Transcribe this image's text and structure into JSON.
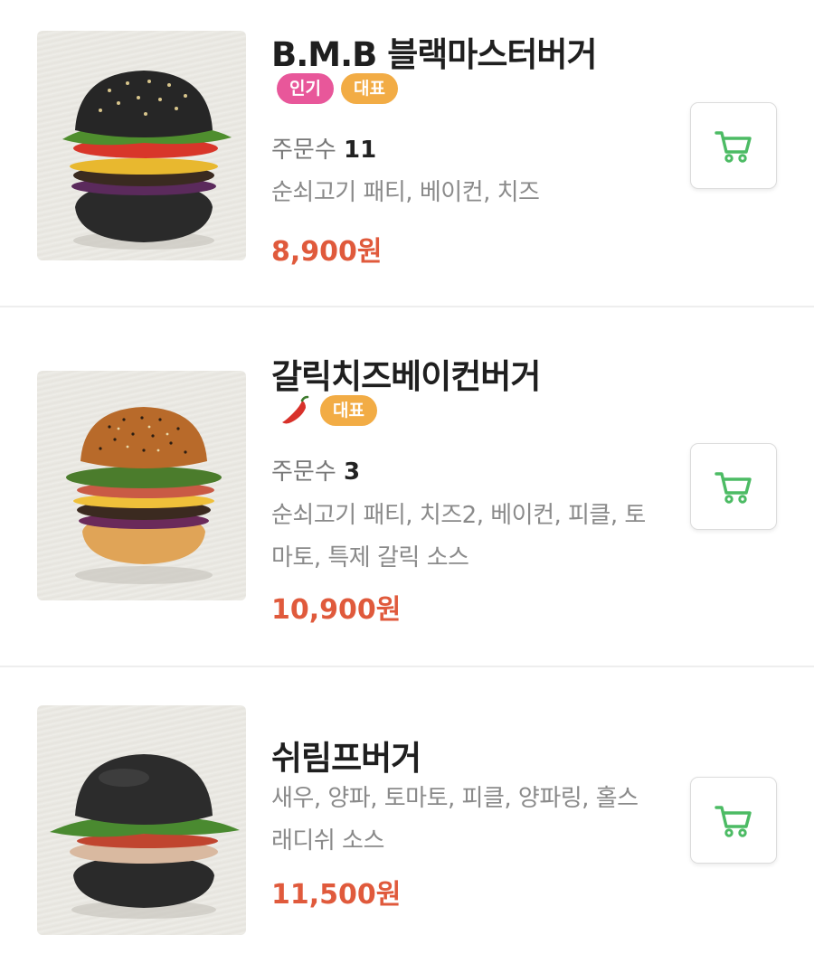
{
  "colors": {
    "accent_price": "#e05a3c",
    "badge_popular": "#e8579a",
    "badge_signature": "#f2ac45",
    "cart_icon": "#4cbb64"
  },
  "items": [
    {
      "name": "B.M.B 블랙마스터버거",
      "badges": [
        "인기",
        "대표"
      ],
      "orders_label": "주문수",
      "orders_count": "11",
      "description": "순쇠고기 패티, 베이컨, 치즈",
      "price": "8,900원",
      "image_icon": "black-burger-photo"
    },
    {
      "name": "갈릭치즈베이컨버거",
      "badges": [
        "대표"
      ],
      "spicy_icon": "chili-pepper-icon",
      "orders_label": "주문수",
      "orders_count": "3",
      "description": "순쇠고기 패티, 치즈2, 베이컨, 피클, 토마토, 특제 갈릭 소스",
      "price": "10,900원",
      "image_icon": "sesame-burger-photo"
    },
    {
      "name": "쉬림프버거",
      "description": "새우, 양파, 토마토, 피클, 양파링, 홀스래디쉬 소스",
      "price": "11,500원",
      "image_icon": "black-shrimp-burger-photo"
    }
  ]
}
